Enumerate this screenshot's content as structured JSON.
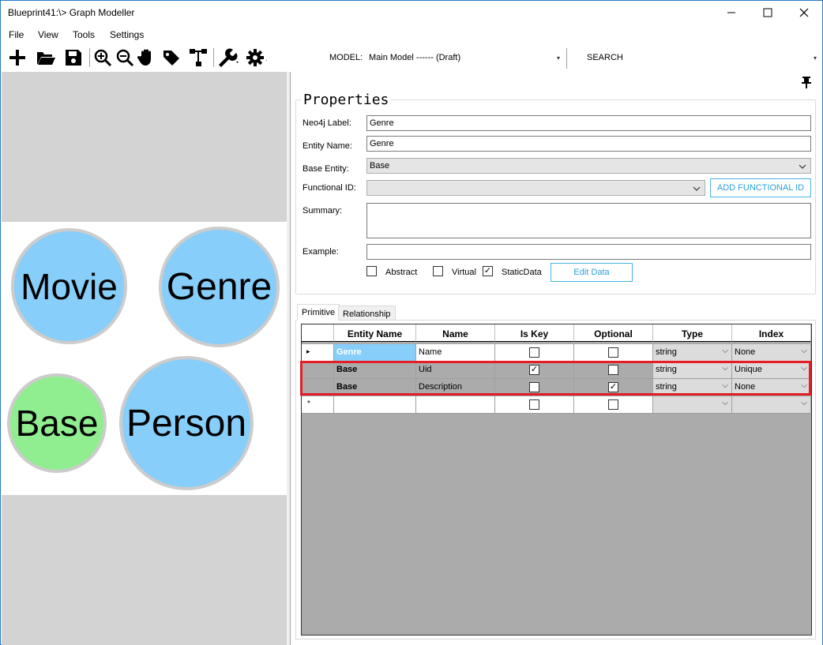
{
  "window": {
    "title": "Blueprint41:\\> Graph Modeller",
    "minimize_glyph": "—",
    "maximize_glyph": "☐",
    "close_glyph": "✕"
  },
  "menu": {
    "items": [
      {
        "label": "File"
      },
      {
        "label": "View"
      },
      {
        "label": "Tools"
      },
      {
        "label": "Settings"
      }
    ]
  },
  "toolbar": {
    "icons": [
      "add-icon",
      "open-folder-icon",
      "save-icon",
      "zoom-in-icon",
      "zoom-out-icon",
      "hand-pan-icon",
      "tag-icon",
      "hierarchy-icon",
      "wrench-icon",
      "gear-icon"
    ],
    "model_label": "MODEL:",
    "model_value": "Main Model ------ (Draft)",
    "search_label": "SEARCH",
    "dropdown_glyph": "▾"
  },
  "canvas": {
    "nodes": [
      {
        "label": "Movie",
        "color": "#87cefa"
      },
      {
        "label": "Genre",
        "color": "#87cefa"
      },
      {
        "label": "Base",
        "color": "#90ee90"
      },
      {
        "label": "Person",
        "color": "#87cefa"
      }
    ]
  },
  "properties": {
    "title": "Properties",
    "neo4j_label_caption": "Neo4j Label:",
    "neo4j_label_value": "Genre",
    "entity_name_caption": "Entity Name:",
    "entity_name_value": "Genre",
    "base_entity_caption": "Base Entity:",
    "base_entity_value": "Base",
    "functional_id_caption": "Functional ID:",
    "functional_id_value": "",
    "add_functional_id_label": "ADD FUNCTIONAL ID",
    "summary_caption": "Summary:",
    "summary_value": "",
    "example_caption": "Example:",
    "example_value": "",
    "abstract_label": "Abstract",
    "abstract_checked": false,
    "virtual_label": "Virtual",
    "virtual_checked": false,
    "staticdata_label": "StaticData",
    "staticdata_checked": true,
    "edit_data_label": "Edit Data",
    "accent_color": "#4ab2e8"
  },
  "tabs": [
    {
      "label": "Primitive",
      "active": true
    },
    {
      "label": "Relationship",
      "active": false
    }
  ],
  "grid": {
    "columns": [
      "Entity Name",
      "Name",
      "Is Key",
      "Optional",
      "Type",
      "Index"
    ],
    "row_marker_current": "▸",
    "row_marker_new": "*",
    "check_glyph": "✓",
    "combo_arrow": "⌵",
    "rows": [
      {
        "entity": "Genre",
        "name": "Name",
        "is_key": false,
        "optional": false,
        "type": "string",
        "index": "None",
        "inherited": false
      },
      {
        "entity": "Base",
        "name": "Uid",
        "is_key": true,
        "optional": false,
        "type": "string",
        "index": "Unique",
        "inherited": true
      },
      {
        "entity": "Base",
        "name": "Description",
        "is_key": false,
        "optional": true,
        "type": "string",
        "index": "None",
        "inherited": true
      },
      {
        "entity": "",
        "name": "",
        "is_key": false,
        "optional": false,
        "type": "",
        "index": "",
        "inherited": false
      }
    ],
    "highlight_color": "#e41e26"
  }
}
